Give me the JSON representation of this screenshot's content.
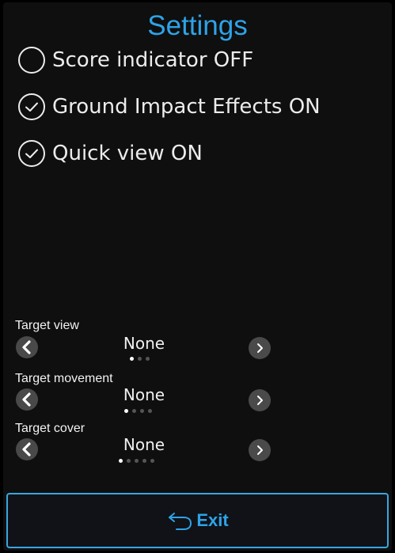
{
  "header": {
    "title": "Settings"
  },
  "toggles": [
    {
      "label": "Score indicator OFF",
      "checked": false
    },
    {
      "label": "Ground Impact Effects ON",
      "checked": true
    },
    {
      "label": "Quick view ON",
      "checked": true
    }
  ],
  "selectors": [
    {
      "label": "Target view",
      "value": "None",
      "option_count": 3,
      "selected_index": 0
    },
    {
      "label": "Target movement",
      "value": "None",
      "option_count": 4,
      "selected_index": 0
    },
    {
      "label": "Target cover",
      "value": "None",
      "option_count": 5,
      "selected_index": 0
    }
  ],
  "footer": {
    "exit_label": "Exit"
  },
  "icons": {
    "unchecked": "circle-outline-icon",
    "checked": "check-circle-icon",
    "prev": "chevron-left-icon",
    "next": "chevron-right-icon",
    "exit": "undo-arrow-icon"
  },
  "colors": {
    "accent": "#2ea3e8",
    "background": "#0f0f0f",
    "text": "#ececec",
    "button_bg": "#494949"
  }
}
